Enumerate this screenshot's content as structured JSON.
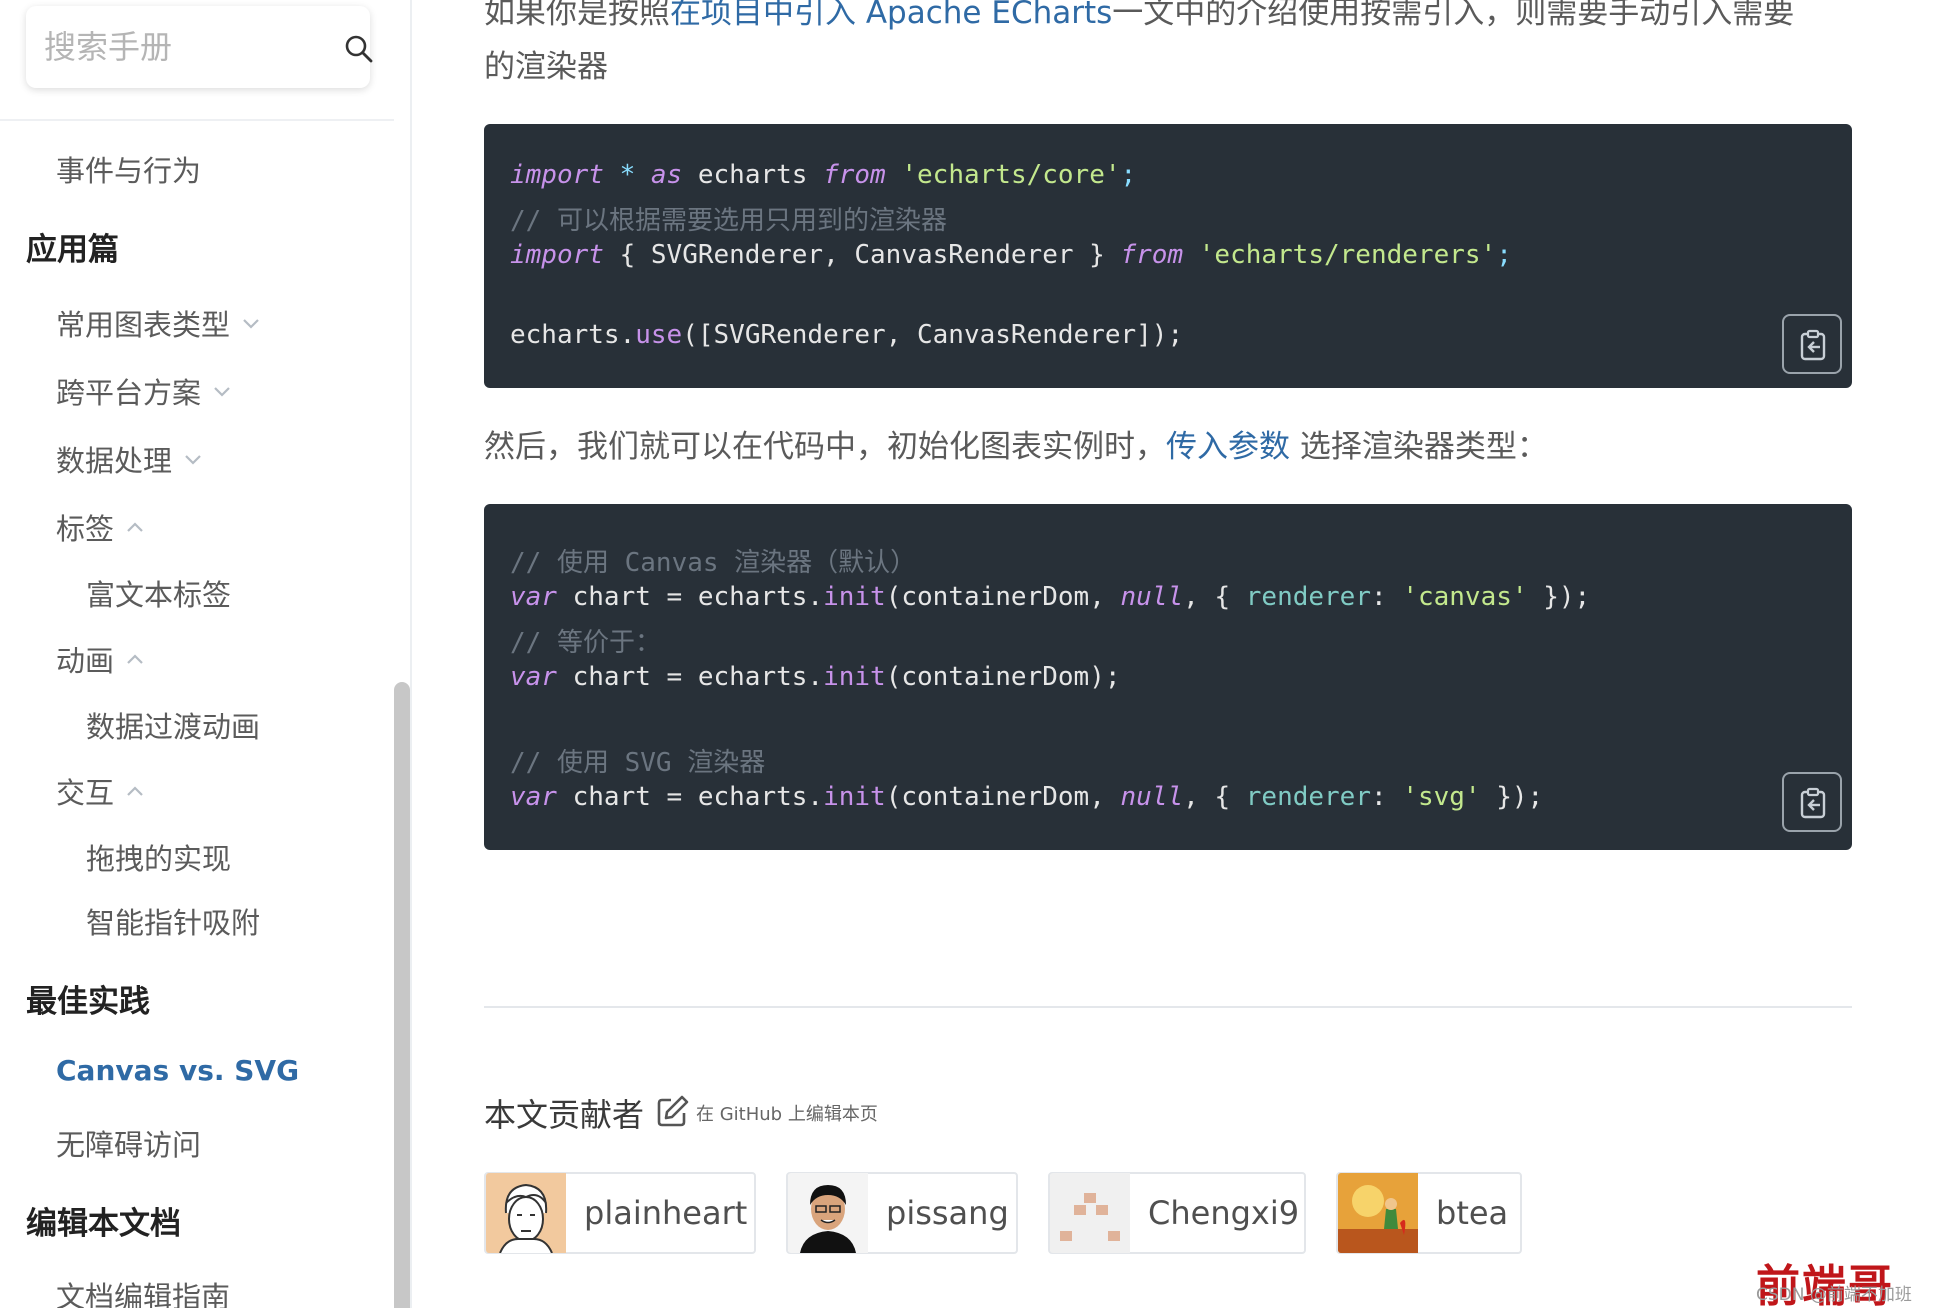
{
  "sidebar": {
    "search_placeholder": "搜索手册",
    "items": [
      {
        "label": "事件与行为"
      },
      {
        "heading": "应用篇"
      },
      {
        "label": "常用图表类型"
      },
      {
        "label": "跨平台方案"
      },
      {
        "label": "数据处理"
      },
      {
        "label": "标签"
      },
      {
        "label": "富文本标签"
      },
      {
        "label": "动画"
      },
      {
        "label": "数据过渡动画"
      },
      {
        "label": "交互"
      },
      {
        "label": "拖拽的实现"
      },
      {
        "label": "智能指针吸附"
      },
      {
        "heading": "最佳实践"
      },
      {
        "label": "Canvas vs. SVG"
      },
      {
        "label": "无障碍访问"
      },
      {
        "heading": "编辑本文档"
      },
      {
        "label": "文档编辑指南"
      }
    ]
  },
  "main": {
    "intro": {
      "prefix": "如果你是按照",
      "link": "在项目中引入 Apache ECharts",
      "suffix": "一文中的介绍使用按需引入，则需要手动引入需要",
      "line2": "的渲染器"
    },
    "code1": {
      "l1": {
        "kw1": "import",
        "star": " * ",
        "kw2": "as",
        "name": " echarts ",
        "kw3": "from",
        "str": " 'echarts/core'",
        "end": ";"
      },
      "l2": "// 可以根据需要选用只用到的渲染器",
      "l3": {
        "kw1": "import",
        "body": " { SVGRenderer, CanvasRenderer } ",
        "kw2": "from",
        "str": " 'echarts/renderers'",
        "end": ";"
      },
      "l4": {
        "obj": "echarts.",
        "fn": "use",
        "args": "([SVGRenderer, CanvasRenderer]);"
      }
    },
    "then": {
      "prefix": "然后，我们就可以在代码中，初始化图表实例时，",
      "link": "传入参数",
      "suffix": " 选择渲染器类型："
    },
    "code2": {
      "c1": "// 使用 Canvas 渲染器（默认）",
      "l1": {
        "kw": "var",
        "a": " chart = echarts.",
        "fn": "init",
        "b": "(containerDom, ",
        "nul": "null",
        "c": ", { ",
        "prop": "renderer",
        "d": ": ",
        "str": "'canvas'",
        "e": " });"
      },
      "c2": "// 等价于：",
      "l2": {
        "kw": "var",
        "a": " chart = echarts.",
        "fn": "init",
        "b": "(containerDom);"
      },
      "c3": "// 使用 SVG 渲染器",
      "l3": {
        "kw": "var",
        "a": " chart = echarts.",
        "fn": "init",
        "b": "(containerDom, ",
        "nul": "null",
        "c": ", { ",
        "prop": "renderer",
        "d": ": ",
        "str": "'svg'",
        "e": " });"
      }
    },
    "contributors_title": "本文贡献者",
    "edit_link": "在 GitHub 上编辑本页",
    "contributors": [
      {
        "name": "plainheart"
      },
      {
        "name": "pissang"
      },
      {
        "name": "Chengxi9"
      },
      {
        "name": "btea"
      }
    ]
  },
  "watermark": {
    "brand": "前端哥",
    "sub": "CSDN @前端不加班"
  },
  "icons": [
    "search-icon",
    "chevron-down-icon",
    "chevron-up-icon",
    "copy-icon",
    "edit-icon"
  ],
  "colors": {
    "link": "#2f6aa5",
    "code_bg": "#283038",
    "watermark": "#c0161a"
  }
}
